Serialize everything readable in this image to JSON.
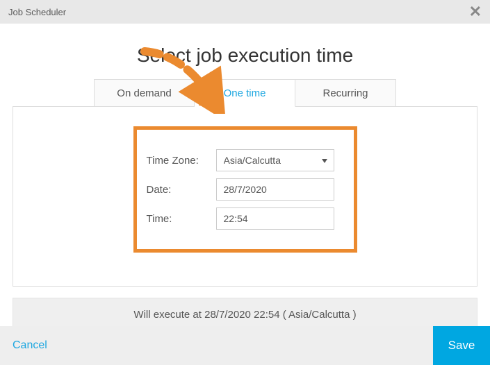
{
  "header": {
    "title": "Job Scheduler"
  },
  "main": {
    "heading": "Select job execution time",
    "tabs": {
      "on_demand": "On demand",
      "one_time": "One time",
      "recurring": "Recurring"
    },
    "form": {
      "timezone_label": "Time Zone:",
      "timezone_value": "Asia/Calcutta",
      "date_label": "Date:",
      "date_value": "28/7/2020",
      "time_label": "Time:",
      "time_value": "22:54"
    },
    "status_text": "Will execute at 28/7/2020 22:54 ( Asia/Calcutta )"
  },
  "footer": {
    "cancel_label": "Cancel",
    "save_label": "Save"
  },
  "colors": {
    "accent": "#1ea7e0",
    "highlight_border": "#eb8a2f",
    "save_bg": "#00a7e1"
  }
}
